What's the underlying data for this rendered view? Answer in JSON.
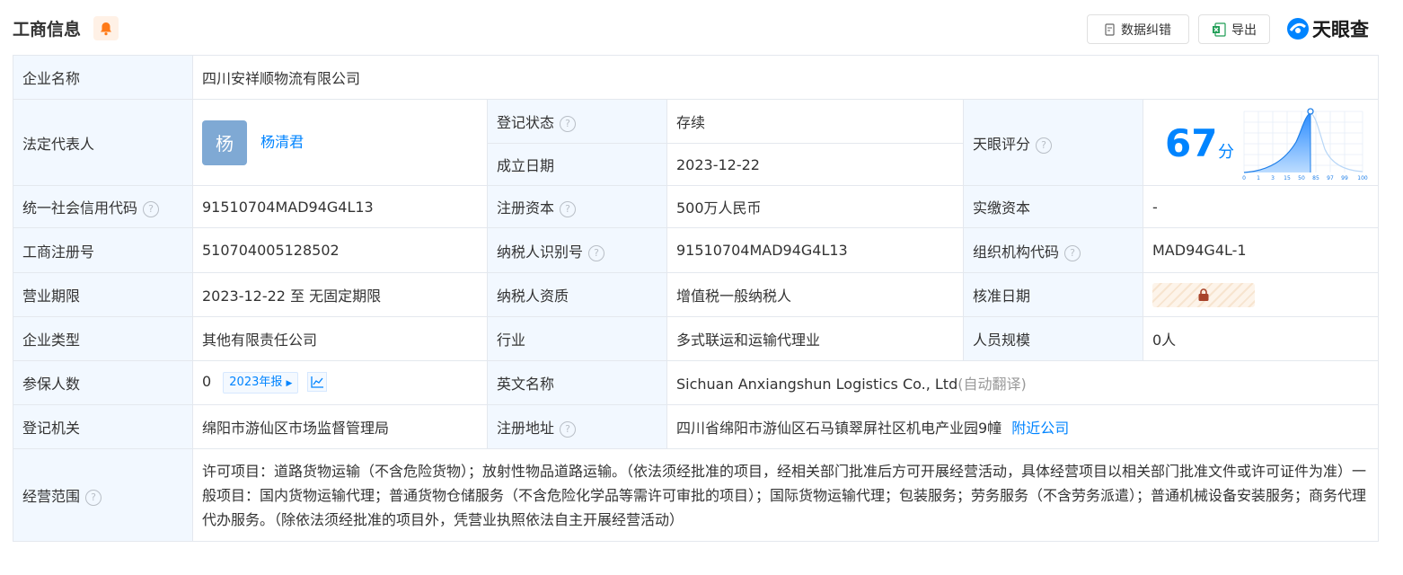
{
  "header": {
    "title": "工商信息",
    "correct_button": "数据纠错",
    "export_button": "导出",
    "logo_text": "天眼查"
  },
  "company_name": {
    "label": "企业名称",
    "value": "四川安祥顺物流有限公司"
  },
  "legal_rep": {
    "label": "法定代表人",
    "avatar_char": "杨",
    "name": "杨清君"
  },
  "reg_status": {
    "label": "登记状态",
    "value": "存续"
  },
  "est_date": {
    "label": "成立日期",
    "value": "2023-12-22"
  },
  "tianyan_score": {
    "label": "天眼评分",
    "score": "67",
    "unit": "分",
    "axis_ticks": [
      "0",
      "1",
      "3",
      "15",
      "50",
      "85",
      "97",
      "99",
      "100"
    ]
  },
  "credit_code": {
    "label": "统一社会信用代码",
    "value": "91510704MAD94G4L13"
  },
  "reg_capital": {
    "label": "注册资本",
    "value": "500万人民币"
  },
  "paid_capital": {
    "label": "实缴资本",
    "value": "-"
  },
  "reg_number": {
    "label": "工商注册号",
    "value": "510704005128502"
  },
  "taxpayer_id": {
    "label": "纳税人识别号",
    "value": "91510704MAD94G4L13"
  },
  "org_code": {
    "label": "组织机构代码",
    "value": "MAD94G4L-1"
  },
  "business_term": {
    "label": "营业期限",
    "value": "2023-12-22 至 无固定期限"
  },
  "taxpayer_qual": {
    "label": "纳税人资质",
    "value": "增值税一般纳税人"
  },
  "approval_date": {
    "label": "核准日期"
  },
  "company_type": {
    "label": "企业类型",
    "value": "其他有限责任公司"
  },
  "industry": {
    "label": "行业",
    "value": "多式联运和运输代理业"
  },
  "staff_size": {
    "label": "人员规模",
    "value": "0人"
  },
  "insured": {
    "label": "参保人数",
    "value": "0",
    "report": "2023年报"
  },
  "english_name": {
    "label": "英文名称",
    "value": "Sichuan Anxiangshun Logistics Co., Ltd",
    "note": "(自动翻译)"
  },
  "reg_authority": {
    "label": "登记机关",
    "value": "绵阳市游仙区市场监督管理局"
  },
  "reg_address": {
    "label": "注册地址",
    "value": "四川省绵阳市游仙区石马镇翠屏社区机电产业园9幢",
    "nearby": "附近公司"
  },
  "business_scope": {
    "label": "经营范围",
    "value": "许可项目：道路货物运输（不含危险货物）；放射性物品道路运输。（依法须经批准的项目，经相关部门批准后方可开展经营活动，具体经营项目以相关部门批准文件或许可证件为准）一般项目：国内货物运输代理；普通货物仓储服务（不含危险化学品等需许可审批的项目）；国际货物运输代理；包装服务；劳务服务（不含劳务派遣）；普通机械设备安装服务；商务代理代办服务。（除依法须经批准的项目外，凭营业执照依法自主开展经营活动）"
  },
  "colors": {
    "label_bg": "#f2f8ff",
    "accent": "#0084ff",
    "status_green": "#0a9a3d",
    "avatar": "#7fa9d4"
  }
}
